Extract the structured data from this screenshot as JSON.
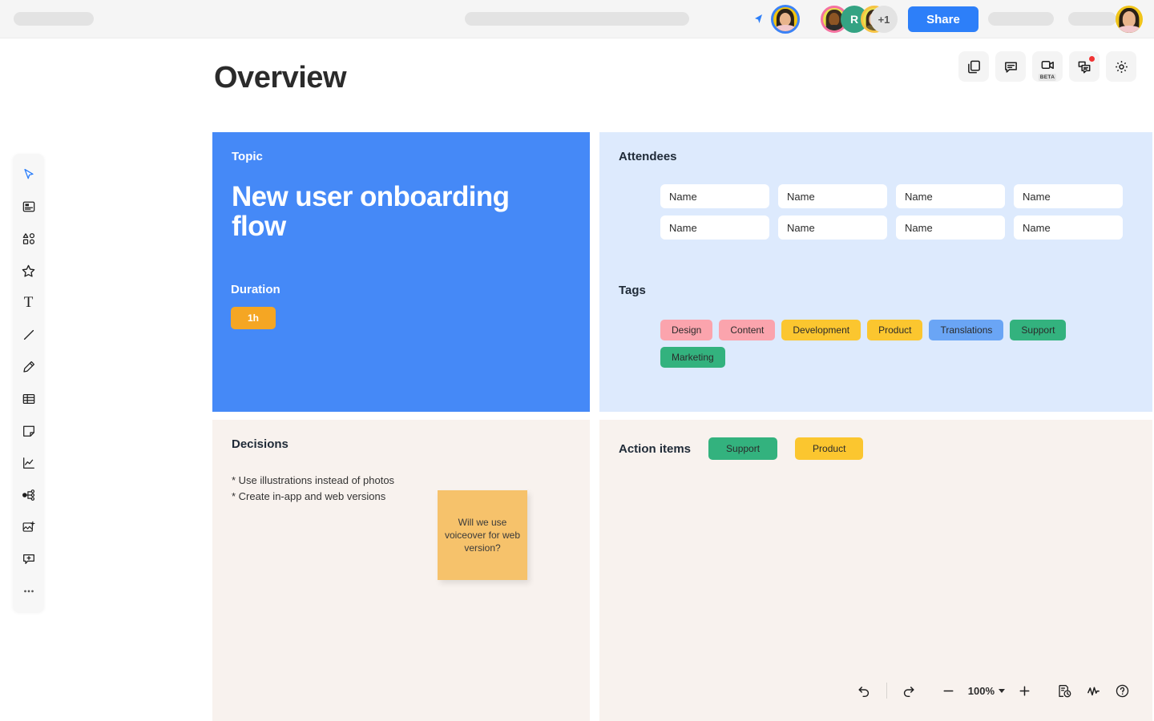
{
  "topbar": {
    "share_label": "Share",
    "overflow_count": "+1",
    "avatar_initial": "R",
    "icons": {
      "cursor": "cursor-pointer-icon",
      "self_avatar": "avatar-self",
      "my_avatar": "avatar-me"
    }
  },
  "header": {
    "title": "Overview",
    "tools": [
      {
        "name": "duplicate-page-icon",
        "label": ""
      },
      {
        "name": "comment-icon",
        "label": ""
      },
      {
        "name": "video-call-icon",
        "label": "BETA"
      },
      {
        "name": "chat-icon",
        "label": ""
      },
      {
        "name": "settings-gear-icon",
        "label": ""
      }
    ]
  },
  "left_toolbar": {
    "items": [
      {
        "name": "select-cursor-tool",
        "active": true
      },
      {
        "name": "template-tool",
        "active": false
      },
      {
        "name": "shapes-tool",
        "active": false
      },
      {
        "name": "star-sticker-tool",
        "active": false
      },
      {
        "name": "text-tool",
        "active": false
      },
      {
        "name": "line-tool",
        "active": false
      },
      {
        "name": "pen-tool",
        "active": false
      },
      {
        "name": "table-tool",
        "active": false
      },
      {
        "name": "sticky-note-tool",
        "active": false
      },
      {
        "name": "chart-tool",
        "active": false
      },
      {
        "name": "mindmap-tool",
        "active": false
      },
      {
        "name": "upload-image-tool",
        "active": false
      },
      {
        "name": "add-comment-tool",
        "active": false
      },
      {
        "name": "more-tools",
        "active": false
      }
    ]
  },
  "topic_card": {
    "label": "Topic",
    "title": "New user onboarding flow",
    "duration_label": "Duration",
    "duration_value": "1h",
    "bg_color": "#4589f7",
    "duration_chip_color": "#f5a623"
  },
  "attendees_card": {
    "heading": "Attendees",
    "bg_color": "#ddeafd",
    "fields": [
      "Name",
      "Name",
      "Name",
      "Name",
      "Name",
      "Name",
      "Name",
      "Name"
    ],
    "tags_heading": "Tags",
    "tags": [
      {
        "label": "Design",
        "color": "#fba4ad"
      },
      {
        "label": "Content",
        "color": "#fba4ad"
      },
      {
        "label": "Development",
        "color": "#fbc62f"
      },
      {
        "label": "Product",
        "color": "#fbc62f"
      },
      {
        "label": "Translations",
        "color": "#6aa5f5"
      },
      {
        "label": "Support",
        "color": "#33b27e"
      },
      {
        "label": "Marketing",
        "color": "#33b27e"
      }
    ]
  },
  "decisions_card": {
    "heading": "Decisions",
    "bg_color": "#f8f2ee",
    "lines": "* Use illustrations instead of photos\n* Create in-app and web versions",
    "sticky_note": {
      "text": "Will we use voiceover for web version?",
      "color": "#f6c26b"
    }
  },
  "actions_card": {
    "heading": "Action items",
    "bg_color": "#f8f2ee",
    "tags": [
      {
        "label": "Support",
        "color": "#33b27e"
      },
      {
        "label": "Product",
        "color": "#fbc62f"
      }
    ]
  },
  "bottom_bar": {
    "zoom_level": "100%",
    "buttons": [
      {
        "name": "undo-button"
      },
      {
        "name": "redo-button"
      },
      {
        "name": "zoom-out-button"
      },
      {
        "name": "zoom-level-dropdown"
      },
      {
        "name": "zoom-in-button"
      },
      {
        "name": "version-history-button"
      },
      {
        "name": "activity-pulse-button"
      },
      {
        "name": "help-button"
      }
    ]
  }
}
